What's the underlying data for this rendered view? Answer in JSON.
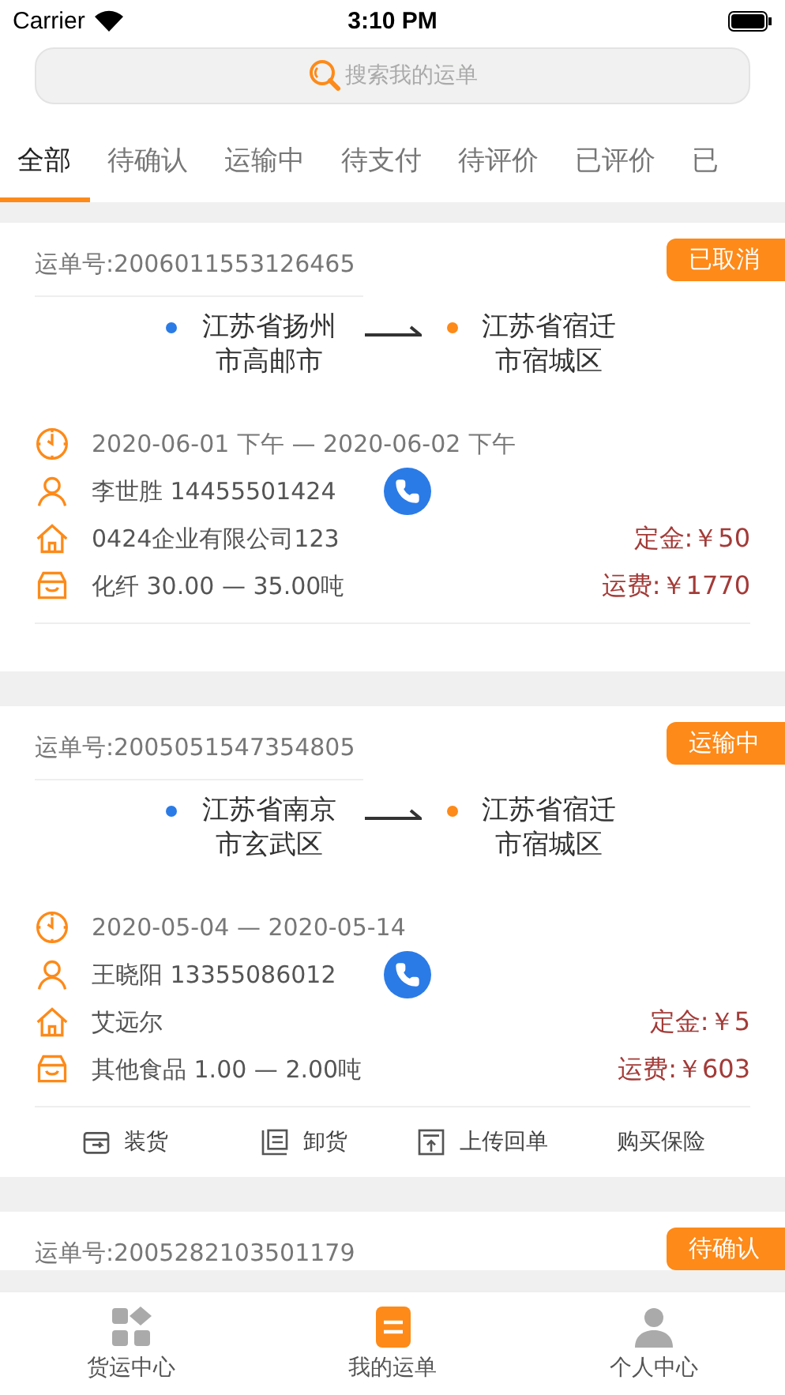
{
  "status_bar": {
    "carrier": "Carrier",
    "time": "3:10 PM"
  },
  "search": {
    "placeholder": "搜索我的运单"
  },
  "tabs": [
    {
      "label": "全部",
      "selected": true
    },
    {
      "label": "待确认",
      "selected": false
    },
    {
      "label": "运输中",
      "selected": false
    },
    {
      "label": "待支付",
      "selected": false
    },
    {
      "label": "待评价",
      "selected": false
    },
    {
      "label": "已评价",
      "selected": false
    },
    {
      "label": "已",
      "selected": false
    }
  ],
  "orders": [
    {
      "number": "运单号:2006011553126465",
      "status": "已取消",
      "from": "江苏省扬州市高邮市",
      "to": "江苏省宿迁市宿城区",
      "time": "2020-06-01 下午 — 2020-06-02 下午",
      "contact": "李世胜 14455501424",
      "company": "0424企业有限公司123",
      "deposit": "定金:￥50",
      "cargo": "化纤 30.00 — 35.00吨",
      "freight": "运费:￥1770"
    },
    {
      "number": "运单号:2005051547354805",
      "status": "运输中",
      "from": "江苏省南京市玄武区",
      "to": "江苏省宿迁市宿城区",
      "time": "2020-05-04  — 2020-05-14",
      "contact": "王晓阳 13355086012",
      "company": "艾远尔",
      "deposit": "定金:￥5",
      "cargo": "其他食品 1.00 — 2.00吨",
      "freight": "运费:￥603",
      "actions": [
        {
          "label": "装货",
          "kind": "load"
        },
        {
          "label": "卸货",
          "kind": "unload"
        },
        {
          "label": "上传回单",
          "kind": "upload"
        },
        {
          "label": "购买保险",
          "kind": "plain"
        }
      ]
    },
    {
      "number": "运单号:2005282103501179",
      "status": "待确认"
    }
  ],
  "bottom_tabs": [
    {
      "label": "货运中心",
      "kind": "grid",
      "selected": false
    },
    {
      "label": "我的运单",
      "kind": "list",
      "selected": true
    },
    {
      "label": "个人中心",
      "kind": "person",
      "selected": false
    }
  ]
}
